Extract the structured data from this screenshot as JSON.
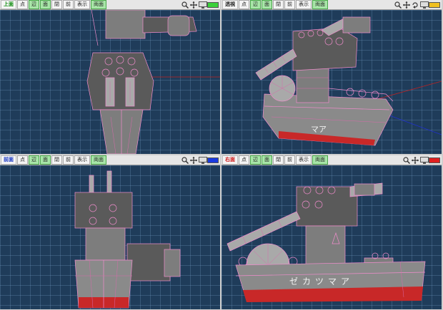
{
  "panes": [
    {
      "id": "top",
      "label": "上面",
      "label_color": "#0a8a0a",
      "swatch": "#3bd13b",
      "tools": [
        "点",
        "辺",
        "面",
        "閉",
        "前",
        "表示",
        "両面"
      ],
      "active": [
        1,
        2,
        6
      ]
    },
    {
      "id": "persp",
      "label": "透視",
      "label_color": "#222222",
      "swatch": "#f0c020",
      "tools": [
        "点",
        "辺",
        "面",
        "閉",
        "前",
        "表示",
        "両面"
      ],
      "active": [
        1,
        2,
        6
      ]
    },
    {
      "id": "front",
      "label": "前面",
      "label_color": "#1030c0",
      "swatch": "#1a3ae0",
      "tools": [
        "点",
        "辺",
        "面",
        "閉",
        "前",
        "表示",
        "両面"
      ],
      "active": [
        1,
        2,
        6
      ]
    },
    {
      "id": "right",
      "label": "右面",
      "label_color": "#cc1010",
      "swatch": "#e02020",
      "tools": [
        "点",
        "辺",
        "面",
        "閉",
        "前",
        "表示",
        "両面"
      ],
      "active": [
        1,
        2,
        6
      ]
    }
  ],
  "hull_text": {
    "persp": "マア",
    "side": "ゼカツマア"
  }
}
